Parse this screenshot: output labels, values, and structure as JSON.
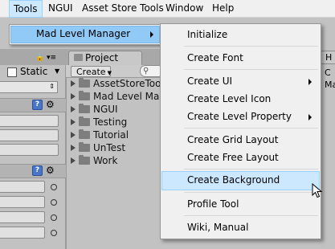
{
  "menubar": {
    "items": [
      "Tools",
      "NGUI",
      "Asset Store Tools",
      "Window",
      "Help"
    ],
    "open_item": "Tools"
  },
  "tools_menu": {
    "item_label": "Mad Level Manager"
  },
  "submenu": {
    "items": [
      {
        "label": "Initialize",
        "has_arrow": false
      },
      {
        "label": "Create Font",
        "has_arrow": false
      },
      {
        "label": "Create UI",
        "has_arrow": true
      },
      {
        "label": "Create Level Icon",
        "has_arrow": false
      },
      {
        "label": "Create Level Property",
        "has_arrow": true
      },
      {
        "label": "Create Grid Layout",
        "has_arrow": false
      },
      {
        "label": "Create Free Layout",
        "has_arrow": false
      },
      {
        "label": "Create Background",
        "has_arrow": false,
        "highlighted": true
      },
      {
        "label": "Profile Tool",
        "has_arrow": false
      },
      {
        "label": "Wiki, Manual",
        "has_arrow": false
      }
    ]
  },
  "inspector": {
    "static_label": "Static"
  },
  "project": {
    "tab_title": "Project",
    "create_label": "Create",
    "folders": [
      "AssetStoreTools",
      "Mad Level Manager",
      "NGUI",
      "Testing",
      "Tutorial",
      "UnTest",
      "Work"
    ]
  },
  "right_panel": {
    "tab_text": "H",
    "text_1": "C",
    "text_2": "Ma"
  },
  "colors": {
    "menu_highlight": "#91c9f7",
    "submenu_highlight": "#cce8ff"
  }
}
